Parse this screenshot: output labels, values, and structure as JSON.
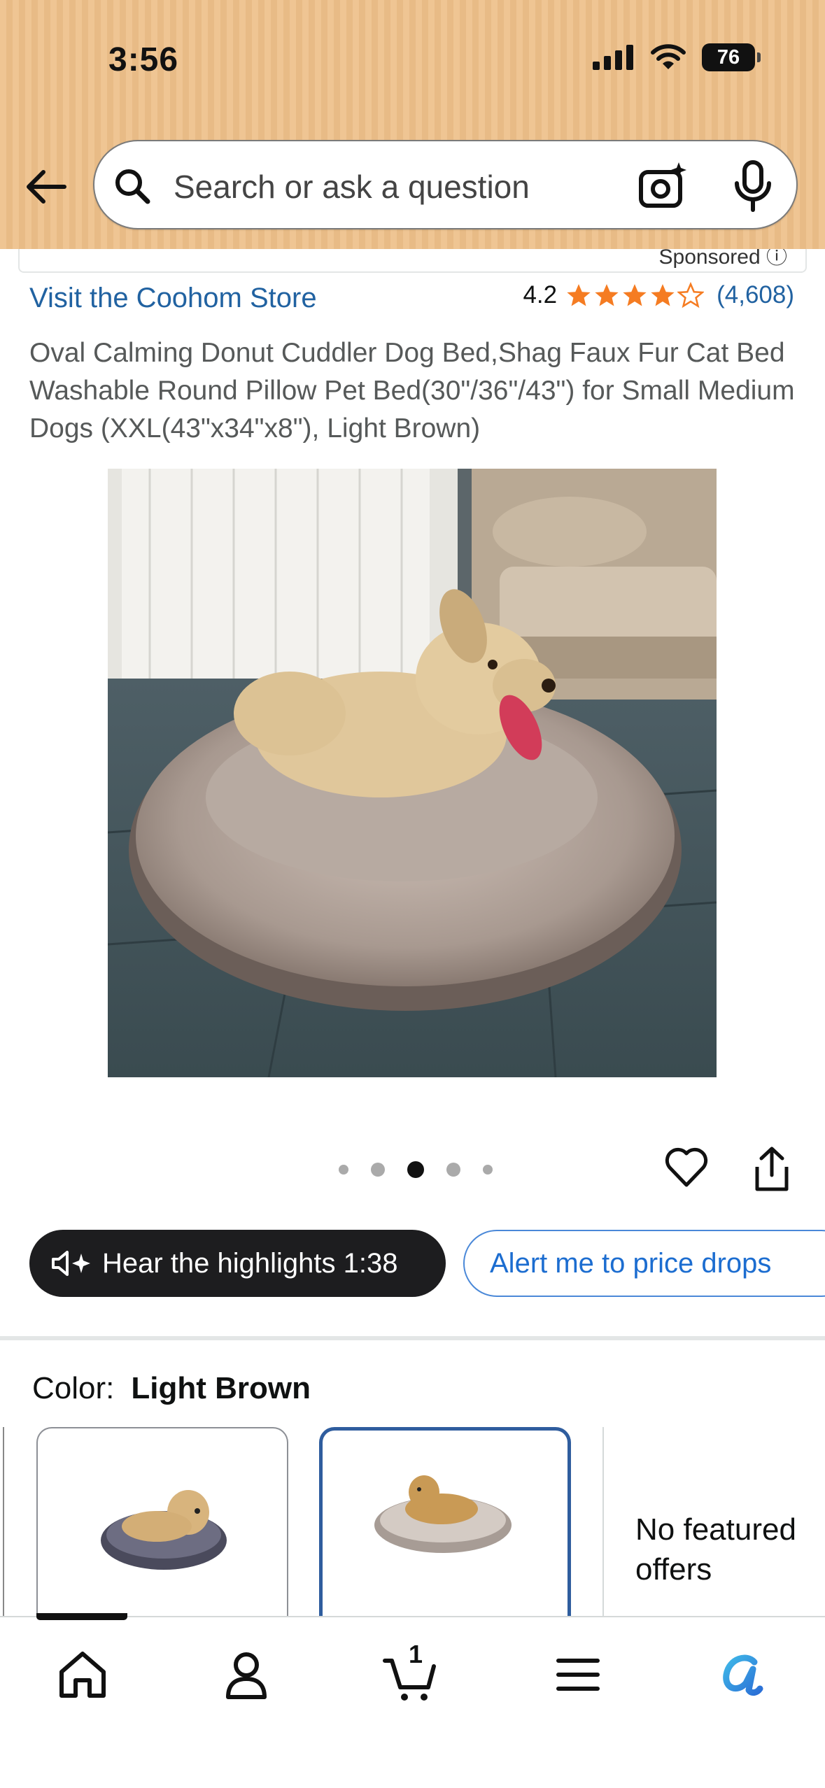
{
  "status": {
    "time": "3:56",
    "battery": "76"
  },
  "search": {
    "placeholder": "Search or ask a question"
  },
  "sponsored": "Sponsored",
  "store": {
    "link": "Visit the Coohom Store",
    "rating": "4.2",
    "reviews": "(4,608)",
    "stars_value": 4.2
  },
  "product": {
    "title": "Oval Calming Donut Cuddler Dog Bed,Shag Faux Fur Cat Bed Washable Round Pillow Pet Bed(30\"/36\"/43\") for Small Medium Dogs (XXL(43\"x34\"x8\"), Light Brown)",
    "image_count": 5,
    "current_image": 3
  },
  "actions": {
    "hear": "Hear the highlights 1:38",
    "alert": "Alert me to price drops"
  },
  "color": {
    "label": "Color:",
    "value": "Light Brown"
  },
  "offers": {
    "no_featured": "No featured offers"
  },
  "nav": {
    "cart_count": "1"
  },
  "colors": {
    "header_bg": "#efc593",
    "link": "#2162a1",
    "star": "#f57c22",
    "selected_border": "#2f5d9e"
  }
}
